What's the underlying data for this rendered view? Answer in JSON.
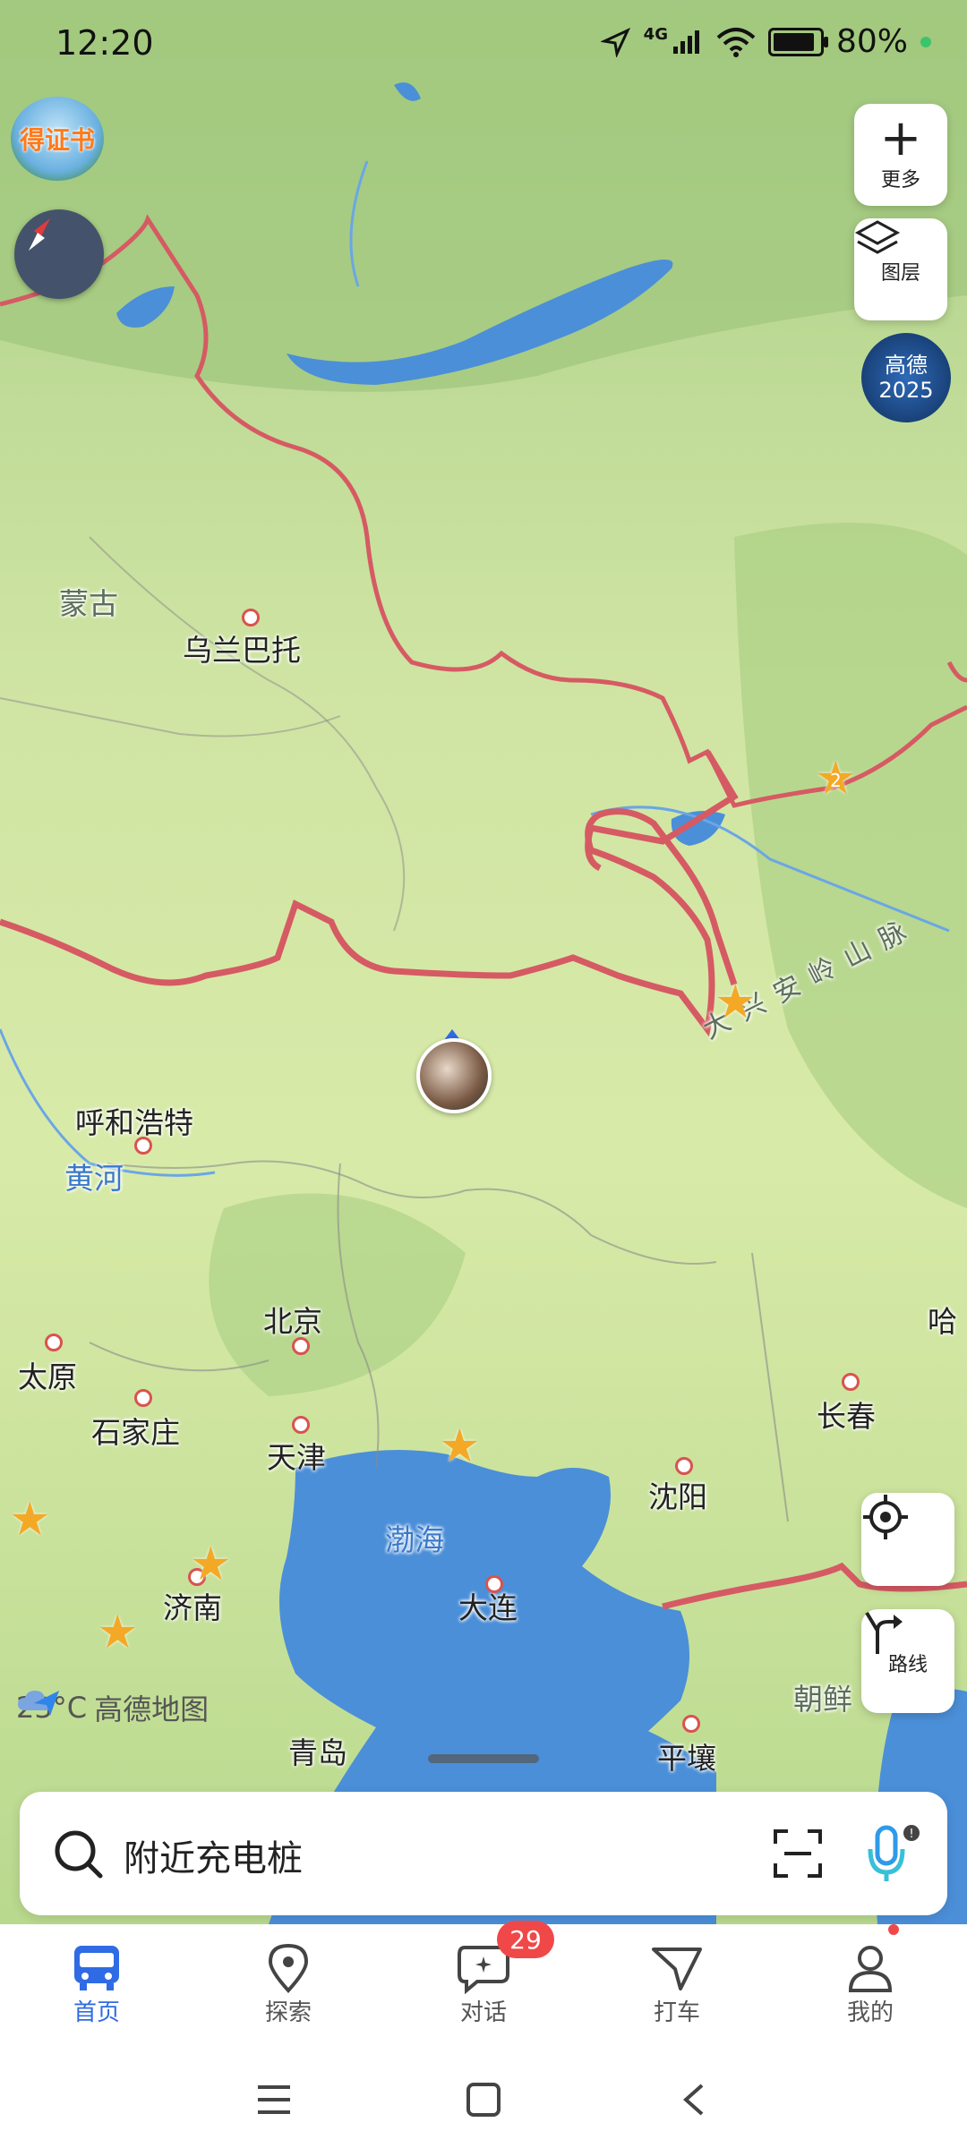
{
  "status_bar": {
    "time": "12:20",
    "network": "4G",
    "battery": "80%"
  },
  "map": {
    "badge_top_left": "得证书",
    "logo_badge": "高德 2025",
    "cities": {
      "ulaanbaatar": "乌兰巴托",
      "hohhot": "呼和浩特",
      "beijing": "北京",
      "tianjin": "天津",
      "taiyuan": "太原",
      "shijiazhuang": "石家庄",
      "jinan": "济南",
      "qingdao": "青岛",
      "dalian": "大连",
      "shenyang": "沈阳",
      "changchun": "长春",
      "pyongyang": "平壤",
      "harbin_partial": "哈"
    },
    "regions": {
      "mongolia": "蒙古",
      "korea_partial": "朝鲜"
    },
    "water": {
      "yellow_river": "黄河",
      "bohai": "渤海"
    },
    "mountains": "大兴安岭山脉",
    "star_labels": {
      "star2": "2"
    }
  },
  "right_buttons": {
    "more_label": "更多",
    "layers_label": "图层",
    "route_label": "路线"
  },
  "weather": {
    "temp": "23°C",
    "brand": "高德地图"
  },
  "search": {
    "placeholder": "附近充电桩"
  },
  "tabs": [
    {
      "label": "首页"
    },
    {
      "label": "探索"
    },
    {
      "label": "对话",
      "badge": "29"
    },
    {
      "label": "打车"
    },
    {
      "label": "我的"
    }
  ],
  "colors": {
    "accent": "#2f6be4",
    "border": "#d65a63",
    "land": "#cfe6a2",
    "water": "#4b8fd8",
    "badge": "#f04848"
  }
}
